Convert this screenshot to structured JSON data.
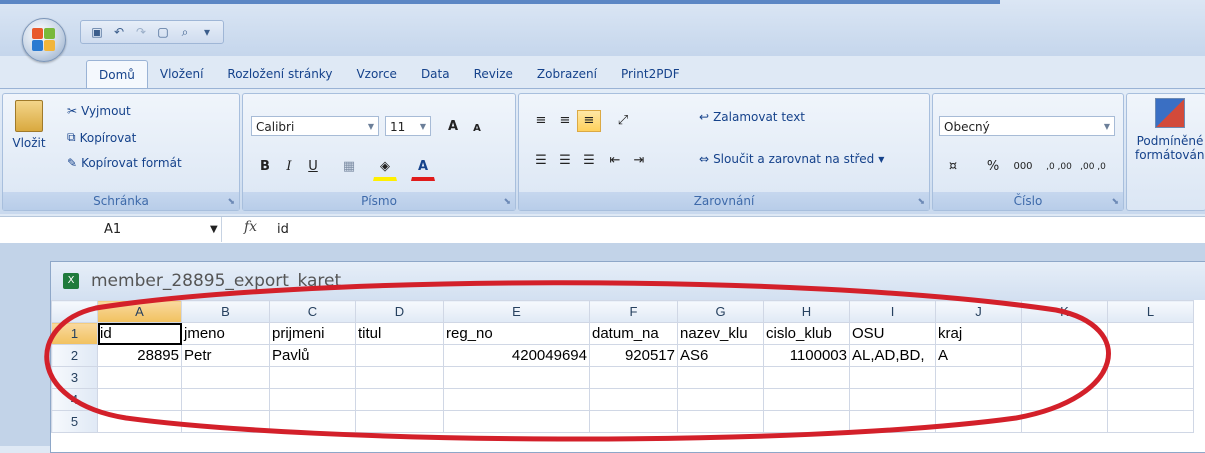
{
  "quick_access": [
    "save-icon",
    "undo-icon",
    "redo-icon",
    "new-icon",
    "print-preview-icon",
    "customize-icon"
  ],
  "tabs": [
    "Domů",
    "Vložení",
    "Rozložení stránky",
    "Vzorce",
    "Data",
    "Revize",
    "Zobrazení",
    "Print2PDF"
  ],
  "active_tab": "Domů",
  "ribbon": {
    "clipboard": {
      "paste": "Vložit",
      "cut": "Vyjmout",
      "copy": "Kopírovat",
      "format_painter": "Kopírovat formát",
      "label": "Schránka"
    },
    "font": {
      "name": "Calibri",
      "size": "11",
      "label": "Písmo",
      "bold": "B",
      "italic": "I",
      "underline": "U",
      "grow": "A",
      "shrink": "A"
    },
    "alignment": {
      "wrap": "Zalamovat text",
      "merge": "Sloučit a zarovnat na střed",
      "label": "Zarovnání"
    },
    "number": {
      "format": "Obecný",
      "percent": "%",
      "thousands": "000",
      "inc_dec": ",0 ,00",
      "dec_dec": ",00 ,0",
      "label": "Číslo"
    },
    "styles": {
      "conditional": "Podmíněné",
      "conditional2": "formátování"
    }
  },
  "formula_bar": {
    "cell": "A1",
    "fx": "fx",
    "value": "id"
  },
  "workbook": {
    "title": "member_28895_export_karet"
  },
  "grid": {
    "columns": [
      "A",
      "B",
      "C",
      "D",
      "E",
      "F",
      "G",
      "H",
      "I",
      "J",
      "K",
      "L"
    ],
    "rows": [
      {
        "n": "1",
        "cells": [
          "id",
          "jmeno",
          "prijmeni",
          "titul",
          "reg_no",
          "datum_na",
          "nazev_klu",
          "cislo_klub",
          "OSU",
          "kraj",
          "",
          ""
        ]
      },
      {
        "n": "2",
        "cells": [
          "28895",
          "Petr",
          "Pavlů",
          "",
          "420049694",
          "920517",
          "AS6",
          "1100003",
          "AL,AD,BD,",
          "A",
          "",
          ""
        ]
      },
      {
        "n": "3",
        "cells": [
          "",
          "",
          "",
          "",
          "",
          "",
          "",
          "",
          "",
          "",
          "",
          ""
        ]
      },
      {
        "n": "4",
        "cells": [
          "",
          "",
          "",
          "",
          "",
          "",
          "",
          "",
          "",
          "",
          "",
          ""
        ]
      },
      {
        "n": "5",
        "cells": [
          "",
          "",
          "",
          "",
          "",
          "",
          "",
          "",
          "",
          "",
          "",
          ""
        ]
      }
    ]
  },
  "colors": {
    "annotation": "#d3202a",
    "accent": "#15428b"
  }
}
